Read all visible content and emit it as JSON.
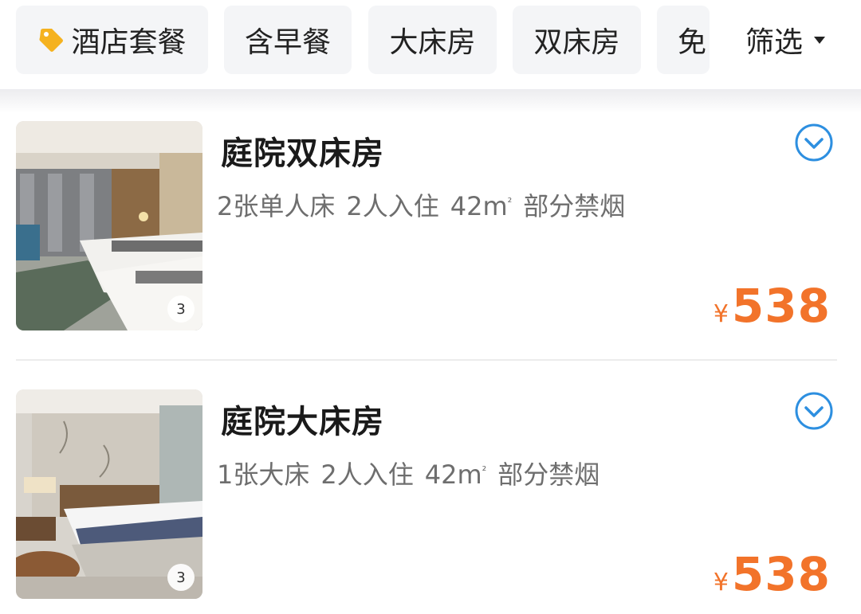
{
  "filters": {
    "chips": [
      {
        "label": "酒店套餐",
        "icon": "tag-icon",
        "icon_color": "#f5b21f"
      },
      {
        "label": "含早餐"
      },
      {
        "label": "大床房"
      },
      {
        "label": "双床房"
      },
      {
        "label": "免"
      }
    ],
    "filter_button": {
      "label": "筛选",
      "icon": "caret-down-icon"
    }
  },
  "rooms": [
    {
      "name": "庭院双床房",
      "bed": "2张单人床",
      "occupancy": "2人入住",
      "area": "42m",
      "area_unit": "²",
      "smoking": "部分禁烟",
      "currency": "¥",
      "price": "538",
      "photo_count": "3",
      "expand_icon": "chevron-down-circle-icon"
    },
    {
      "name": "庭院大床房",
      "bed": "1张大床",
      "occupancy": "2人入住",
      "area": "42m",
      "area_unit": "²",
      "smoking": "部分禁烟",
      "currency": "¥",
      "price": "538",
      "photo_count": "3",
      "expand_icon": "chevron-down-circle-icon"
    }
  ],
  "colors": {
    "price": "#f2732a",
    "accent_blue": "#2d8fe0",
    "chip_bg": "#f4f5f7",
    "tag_icon": "#f5b21f"
  }
}
